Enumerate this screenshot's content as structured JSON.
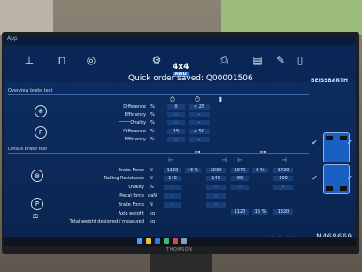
{
  "app": {
    "title": "Quick order saved: Q00001506",
    "logo": "BEISSBARTH",
    "winbar_label": "App",
    "footer_id": "N468669",
    "footnote": "Symbol for Wheel Linked"
  },
  "toolbar": {
    "mode_label": "4x4",
    "mode_sub": "AWD"
  },
  "overview": {
    "section_title": "Overview brake test",
    "rows": [
      {
        "label": "Difference",
        "unit": "%",
        "cells": [
          "0",
          "< 25",
          ""
        ]
      },
      {
        "label": "Efficiency",
        "unit": "%",
        "cells": [
          "-",
          "-",
          ""
        ]
      },
      {
        "label": "Ovality",
        "unit": "%",
        "cells": [
          "-",
          "-",
          ""
        ]
      },
      {
        "label": "Difference",
        "unit": "%",
        "cells": [
          "15",
          "< 50",
          ""
        ]
      },
      {
        "label": "Efficiency",
        "unit": "%",
        "cells": [
          "-",
          "-",
          ""
        ]
      }
    ]
  },
  "details": {
    "section_title": "Details brake test",
    "rows": [
      {
        "label": "Brake Force",
        "unit": "N",
        "cells": [
          "1160",
          "43 %",
          "2030",
          "1070",
          "8 %",
          "1720"
        ]
      },
      {
        "label": "Rolling Resistance",
        "unit": "N",
        "cells": [
          "140",
          "",
          "140",
          "90",
          "",
          "100"
        ]
      },
      {
        "label": "Ovality",
        "unit": "%",
        "cells": [
          "-",
          "",
          "-",
          "-",
          "",
          "-"
        ]
      },
      {
        "label": "Pedal force",
        "unit": "daN",
        "cells": [
          "-",
          "",
          "-",
          "",
          "",
          ""
        ]
      },
      {
        "label": "Brake Force",
        "unit": "N",
        "cells": [
          "-",
          "",
          "-",
          "",
          "",
          ""
        ]
      },
      {
        "label": "Axle weight",
        "unit": "kg",
        "cells": [
          "",
          "",
          "",
          "1120",
          "15 %",
          "1320"
        ]
      },
      {
        "label": "Total weight designed / measured",
        "unit": "kg",
        "cells": [
          "",
          "",
          "",
          "",
          "",
          ""
        ]
      }
    ]
  },
  "brand": "THOMSON",
  "colors": {
    "screen_bg": "#0b2959",
    "toolbar_bg": "#0a2656",
    "cell_bg": "#163f7c",
    "accent": "#2c8cff"
  }
}
